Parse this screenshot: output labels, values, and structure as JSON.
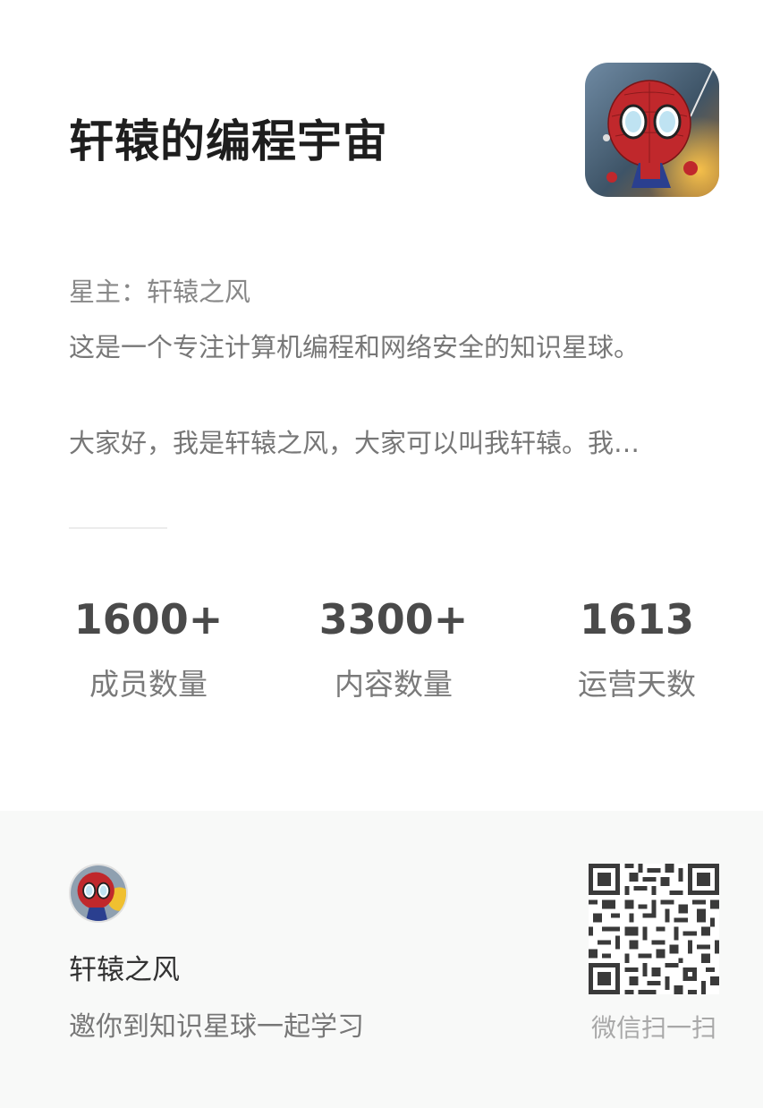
{
  "group": {
    "title": "轩辕的编程宇宙",
    "owner_line": "星主：轩辕之风",
    "description_line1": "这是一个专注计算机编程和网络安全的知识星球。",
    "description_line2": "大家好，我是轩辕之风，大家可以叫我轩辕。我…"
  },
  "stats": [
    {
      "value": "1600+",
      "label": "成员数量"
    },
    {
      "value": "3300+",
      "label": "内容数量"
    },
    {
      "value": "1613",
      "label": "运营天数"
    }
  ],
  "footer": {
    "author_name": "轩辕之风",
    "invite_text": "邀你到知识星球一起学习",
    "scan_hint": "微信扫一扫"
  },
  "icons": {
    "cover": "spiderman-cover-image",
    "avatar": "spiderman-avatar",
    "qr": "qr-code"
  },
  "colors": {
    "title": "#1e1e1e",
    "stat_value": "#4a4a4a",
    "footer_bg": "#f8f9f8"
  }
}
